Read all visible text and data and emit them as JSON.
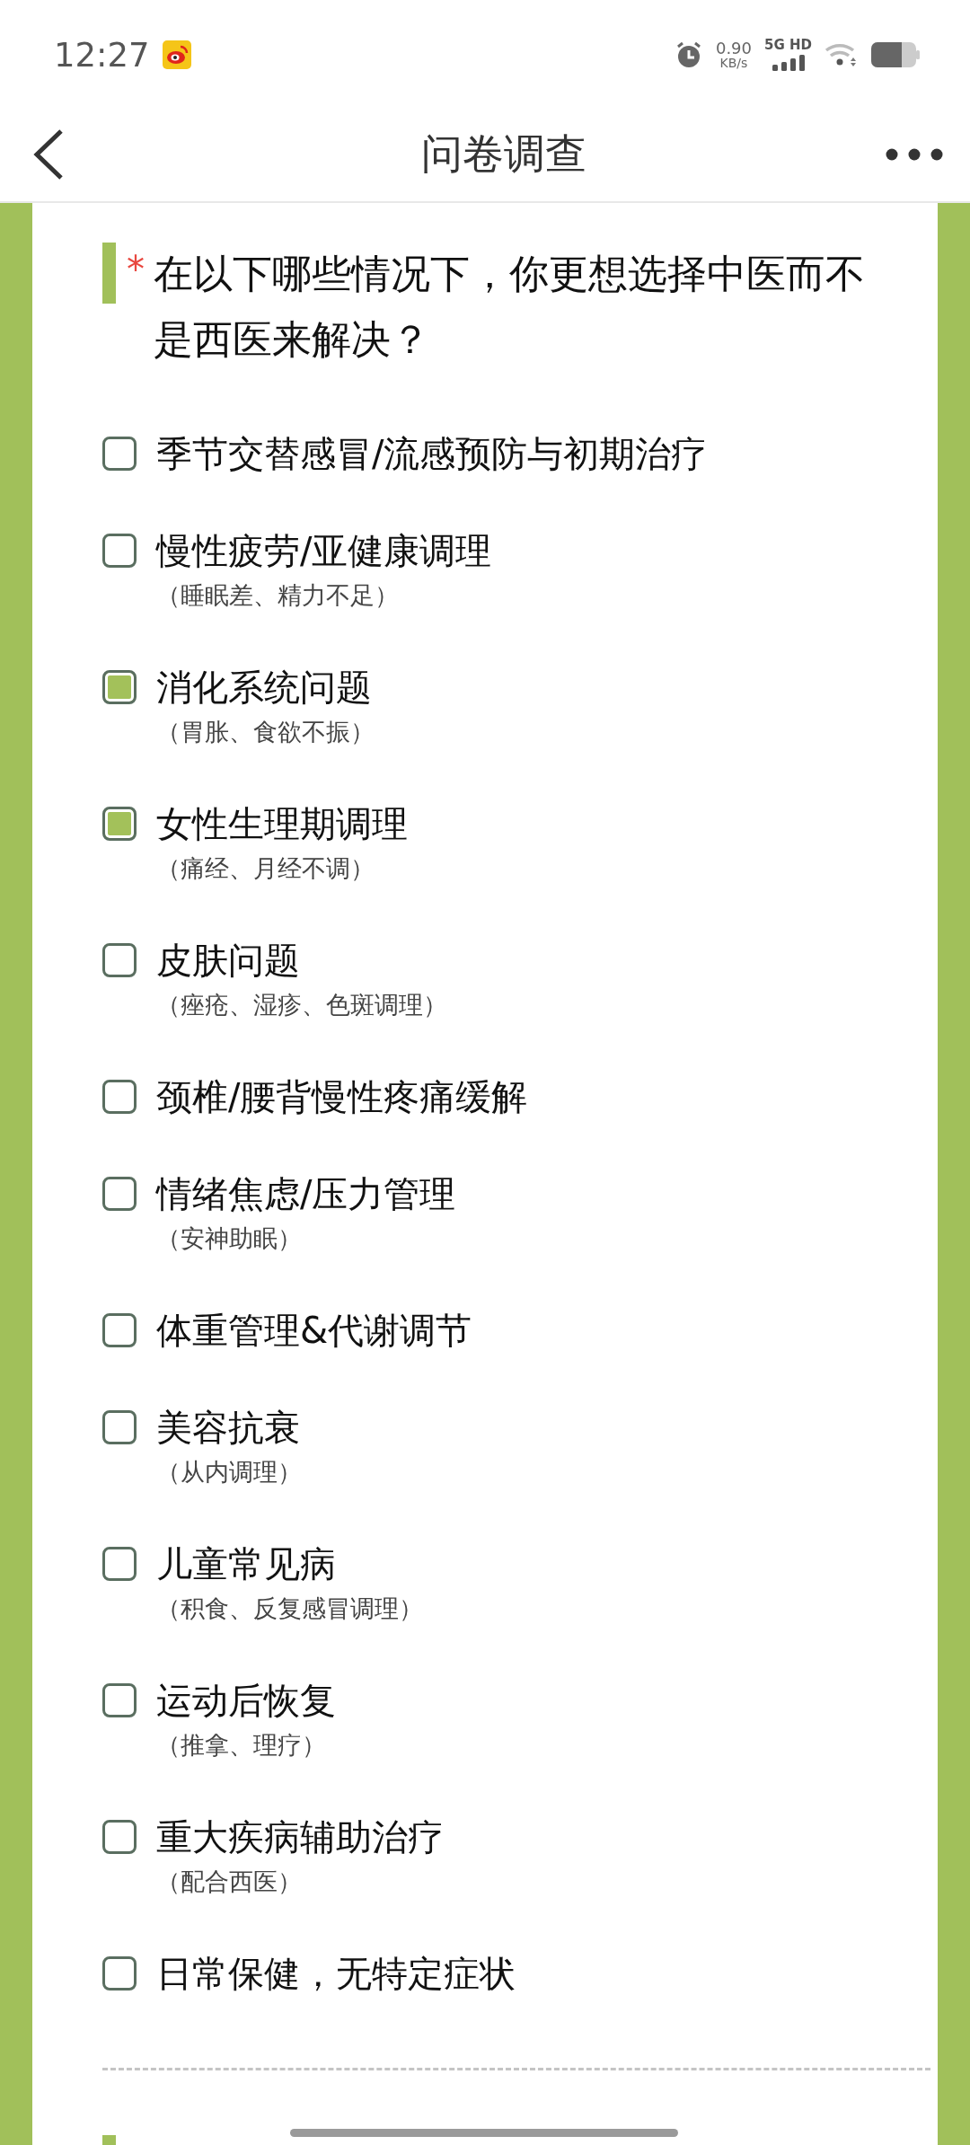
{
  "status_bar": {
    "time": "12:27",
    "network_speed": "0.90",
    "speed_unit": "KB/s",
    "network": "5G HD"
  },
  "header": {
    "title": "问卷调查"
  },
  "question": {
    "required": true,
    "required_mark": "*",
    "title": "在以下哪些情况下，你更想选择中医而不是西医来解决？",
    "options": [
      {
        "label": "季节交替感冒/流感预防与初期治疗",
        "checked": false
      },
      {
        "label": "慢性疲劳/亚健康调理",
        "note": "（睡眠差、精力不足）",
        "checked": false
      },
      {
        "label": "消化系统问题",
        "note": "（胃胀、食欲不振）",
        "checked": true
      },
      {
        "label": "女性生理期调理",
        "note": "（痛经、月经不调）",
        "checked": true
      },
      {
        "label": "皮肤问题",
        "note": "（痤疮、湿疹、色斑调理）",
        "checked": false
      },
      {
        "label": "颈椎/腰背慢性疼痛缓解",
        "checked": false
      },
      {
        "label": "情绪焦虑/压力管理",
        "note": "（安神助眠）",
        "checked": false
      },
      {
        "label": "体重管理&代谢调节",
        "checked": false
      },
      {
        "label": "美容抗衰",
        "note": "（从内调理）",
        "checked": false
      },
      {
        "label": "儿童常见病",
        "note": "（积食、反复感冒调理）",
        "checked": false
      },
      {
        "label": "运动后恢复",
        "note": "（推拿、理疗）",
        "checked": false
      },
      {
        "label": "重大疾病辅助治疗",
        "note": "（配合西医）",
        "checked": false
      },
      {
        "label": "日常保健，无特定症状",
        "checked": false
      }
    ]
  }
}
